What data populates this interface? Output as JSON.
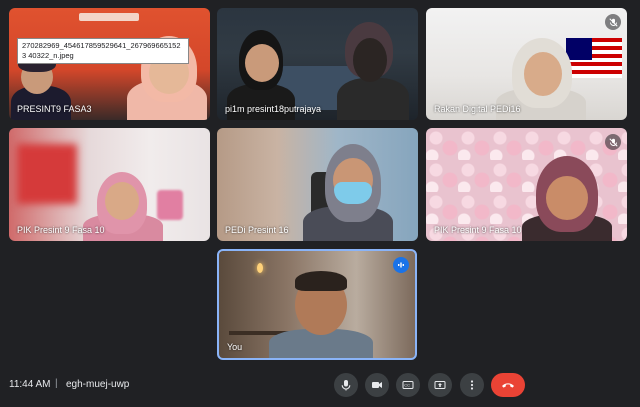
{
  "tooltip": {
    "text": "270282969_454617859529641_2679696651523 40322_n.jpeg"
  },
  "tiles": [
    {
      "name": "PRESINT9 FASA3"
    },
    {
      "name": "pi1m presint18putrajaya"
    },
    {
      "name": "Rakan Digital PEDi16"
    },
    {
      "name": "PIK Presint 9 Fasa 10"
    },
    {
      "name": "PEDi Presint 16"
    },
    {
      "name": "PIK Presint 9 Fasa 10"
    },
    {
      "name": "You"
    }
  ],
  "meeting": {
    "time": "11:44 AM",
    "separator": "|",
    "code": "egh-muej-uwp"
  },
  "controls": [
    "microphone-icon",
    "camera-icon",
    "captions-icon",
    "present-icon",
    "more-options-icon",
    "end-call-icon"
  ],
  "colors": {
    "background": "#202124",
    "control": "#3c4043",
    "end_call": "#ea4335",
    "active_speaker": "#1a73e8"
  }
}
